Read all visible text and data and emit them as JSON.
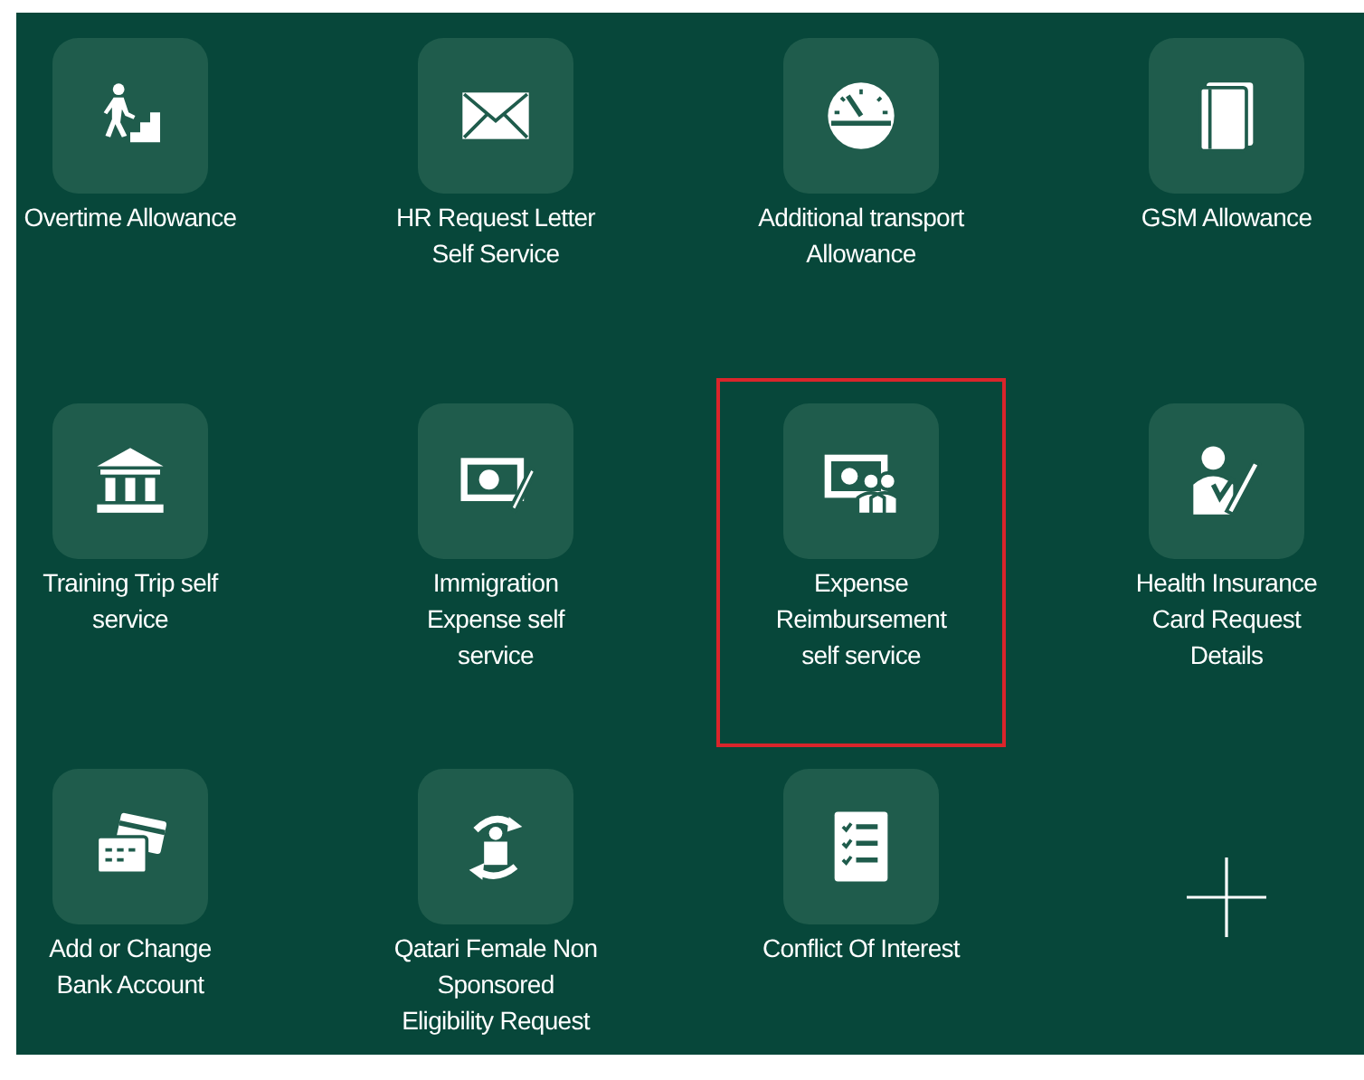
{
  "tiles": [
    {
      "kind": "app",
      "label": "Overtime Allowance",
      "selected": false
    },
    {
      "kind": "app",
      "label": "HR Request Letter Self Service",
      "selected": false
    },
    {
      "kind": "app",
      "label": "Additional transport Allowance",
      "selected": false
    },
    {
      "kind": "app",
      "label": "GSM Allowance",
      "selected": false
    },
    {
      "kind": "app",
      "label": "Training Trip self service",
      "selected": false
    },
    {
      "kind": "app",
      "label": "Immigration Expense self service",
      "selected": false
    },
    {
      "kind": "app",
      "label": "Expense Reimbursement self service",
      "selected": true
    },
    {
      "kind": "app",
      "label": "Health Insurance Card Request Details",
      "selected": false
    },
    {
      "kind": "app",
      "label": "Add or Change Bank Account",
      "selected": false
    },
    {
      "kind": "app",
      "label": "Qatari Female Non Sponsored Eligibility Request",
      "selected": false
    },
    {
      "kind": "app",
      "label": "Conflict Of Interest",
      "selected": false
    },
    {
      "kind": "add"
    }
  ]
}
